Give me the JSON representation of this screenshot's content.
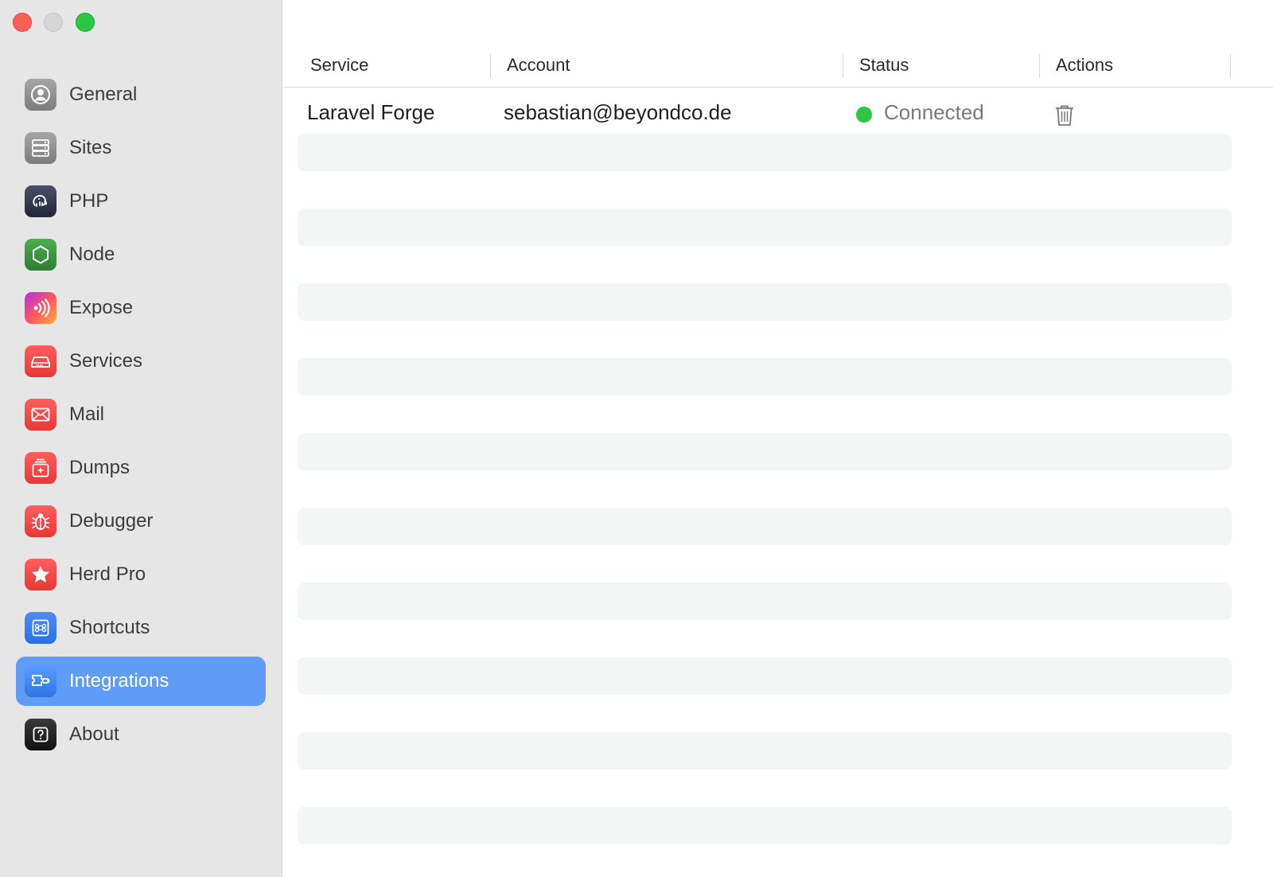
{
  "sidebar": {
    "items": [
      {
        "label": "General",
        "icon": "person-circle-icon",
        "active": false
      },
      {
        "label": "Sites",
        "icon": "server-stack-icon",
        "active": false
      },
      {
        "label": "PHP",
        "icon": "elephant-icon",
        "active": false
      },
      {
        "label": "Node",
        "icon": "hexagon-icon",
        "active": false
      },
      {
        "label": "Expose",
        "icon": "broadcast-icon",
        "active": false
      },
      {
        "label": "Services",
        "icon": "hard-drive-icon",
        "active": false
      },
      {
        "label": "Mail",
        "icon": "envelope-icon",
        "active": false
      },
      {
        "label": "Dumps",
        "icon": "stacked-box-icon",
        "active": false
      },
      {
        "label": "Debugger",
        "icon": "bug-icon",
        "active": false
      },
      {
        "label": "Herd Pro",
        "icon": "star-icon",
        "active": false
      },
      {
        "label": "Shortcuts",
        "icon": "command-key-icon",
        "active": false
      },
      {
        "label": "Integrations",
        "icon": "plug-puzzle-icon",
        "active": true
      },
      {
        "label": "About",
        "icon": "question-mark-icon",
        "active": false
      }
    ]
  },
  "table": {
    "columns": {
      "service": "Service",
      "account": "Account",
      "status": "Status",
      "actions": "Actions"
    },
    "rows": [
      {
        "service": "Laravel Forge",
        "account": "sebastian@beyondco.de",
        "status": "Connected",
        "status_color": "#2bc840",
        "action_icon": "trash-icon"
      }
    ]
  },
  "colors": {
    "accent": "#5f9cf7",
    "status_connected": "#2bc840"
  }
}
